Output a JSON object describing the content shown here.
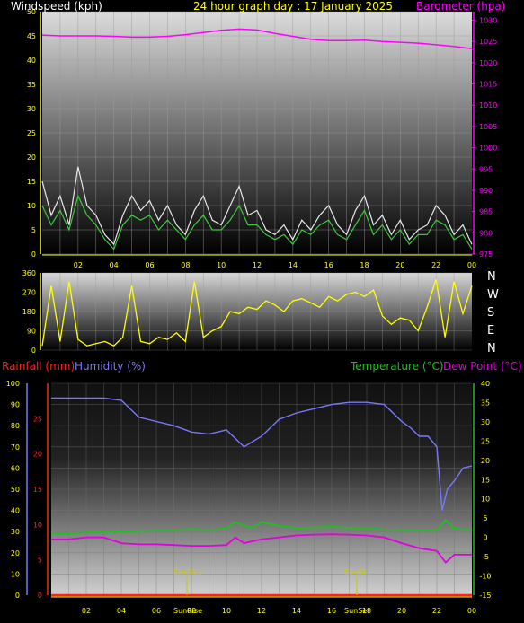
{
  "header": {
    "wind_title": "Windspeed (kph)",
    "date_title": "24 hour graph day : 17 January 2025",
    "baro_title": "Barometer (hpa)"
  },
  "lower_header": {
    "rain_title": "Rainfall (mm)",
    "hum_title": "Humidity (%)",
    "temp_title": "Temperature (°C)",
    "dew_title": "Dew Point (°C)"
  },
  "compass": [
    "N",
    "W",
    "S",
    "E",
    "N"
  ],
  "sun": {
    "rise_label": "SunRise",
    "set_label": "SunSet",
    "rise_hour": 7.6,
    "set_hour": 17.4
  },
  "colors": {
    "bg": "#000000",
    "axis_yellow": "#ffff00",
    "wind_white": "#e8e8e8",
    "wind_green": "#3cc83c",
    "baro": "#ff00ff",
    "dir": "#ffff00",
    "humidity": "#7878ff",
    "temperature": "#20c020",
    "dewpoint": "#e000e0",
    "rain": "#ff2020",
    "title_white": "#ffffff",
    "title_yellow": "#ffff00"
  },
  "chart_data": [
    {
      "type": "line",
      "title": "24 hour graph day : 17 January 2025",
      "ylabel": "Windspeed (kph)",
      "y2label": "Barometer (hpa)",
      "ylim": [
        0,
        50
      ],
      "y2lim": [
        975,
        1032
      ],
      "yticks": [
        0,
        5,
        10,
        15,
        20,
        25,
        30,
        35,
        40,
        45,
        50
      ],
      "y2ticks": [
        975,
        980,
        985,
        990,
        995,
        1000,
        1005,
        1010,
        1015,
        1020,
        1025,
        1030
      ],
      "xticks": [
        "02",
        "04",
        "06",
        "08",
        "10",
        "12",
        "14",
        "16",
        "18",
        "20",
        "22",
        "00"
      ],
      "series": [
        {
          "name": "Windspeed (kph)",
          "axis": "left",
          "x": [
            0,
            0.5,
            1,
            1.5,
            2,
            2.5,
            3,
            3.5,
            4,
            4.5,
            5,
            5.5,
            6,
            6.5,
            7,
            7.5,
            8,
            8.5,
            9,
            9.5,
            10,
            10.5,
            11,
            11.5,
            12,
            12.5,
            13,
            13.5,
            14,
            14.5,
            15,
            15.5,
            16,
            16.5,
            17,
            17.5,
            18,
            18.5,
            19,
            19.5,
            20,
            20.5,
            21,
            21.5,
            22,
            22.5,
            23,
            23.5,
            24
          ],
          "values": [
            15,
            8,
            12,
            6,
            18,
            10,
            8,
            4,
            2,
            8,
            12,
            9,
            11,
            7,
            10,
            6,
            4,
            9,
            12,
            7,
            6,
            10,
            14,
            8,
            9,
            5,
            4,
            6,
            3,
            7,
            5,
            8,
            10,
            6,
            4,
            9,
            12,
            6,
            8,
            4,
            7,
            3,
            5,
            6,
            10,
            8,
            4,
            6,
            2
          ]
        },
        {
          "name": "Wind average",
          "axis": "left",
          "x": [
            0,
            0.5,
            1,
            1.5,
            2,
            2.5,
            3,
            3.5,
            4,
            4.5,
            5,
            5.5,
            6,
            6.5,
            7,
            7.5,
            8,
            8.5,
            9,
            9.5,
            10,
            10.5,
            11,
            11.5,
            12,
            12.5,
            13,
            13.5,
            14,
            14.5,
            15,
            15.5,
            16,
            16.5,
            17,
            17.5,
            18,
            18.5,
            19,
            19.5,
            20,
            20.5,
            21,
            21.5,
            22,
            22.5,
            23,
            23.5,
            24
          ],
          "values": [
            10,
            6,
            9,
            5,
            12,
            8,
            6,
            3,
            1,
            6,
            8,
            7,
            8,
            5,
            7,
            5,
            3,
            6,
            8,
            5,
            5,
            7,
            10,
            6,
            6,
            4,
            3,
            4,
            2,
            5,
            4,
            6,
            7,
            4,
            3,
            6,
            9,
            4,
            6,
            3,
            5,
            2,
            4,
            4,
            7,
            6,
            3,
            4,
            1
          ]
        },
        {
          "name": "Barometer (hpa)",
          "axis": "right",
          "x": [
            0,
            1,
            2,
            3,
            4,
            5,
            6,
            7,
            8,
            9,
            10,
            11,
            12,
            13,
            14,
            15,
            16,
            17,
            18,
            19,
            20,
            21,
            22,
            23,
            24
          ],
          "values": [
            1026.5,
            1026.3,
            1026.3,
            1026.3,
            1026.2,
            1026,
            1026,
            1026.2,
            1026.6,
            1027.1,
            1027.6,
            1027.9,
            1027.7,
            1026.9,
            1026.2,
            1025.5,
            1025.2,
            1025.2,
            1025.3,
            1025,
            1024.8,
            1024.6,
            1024.2,
            1023.8,
            1023.3
          ]
        }
      ]
    },
    {
      "type": "line",
      "ylabel": "Wind direction",
      "ylim": [
        0,
        360
      ],
      "yticks": [
        0,
        90,
        180,
        270,
        360
      ],
      "series": [
        {
          "name": "Wind direction",
          "x": [
            0,
            0.5,
            1,
            1.5,
            2,
            2.5,
            3,
            3.5,
            4,
            4.5,
            5,
            5.5,
            6,
            6.5,
            7,
            7.5,
            8,
            8.5,
            9,
            9.5,
            10,
            10.5,
            11,
            11.5,
            12,
            12.5,
            13,
            13.5,
            14,
            14.5,
            15,
            15.5,
            16,
            16.5,
            17,
            17.5,
            18,
            18.5,
            19,
            19.5,
            20,
            20.5,
            21,
            21.5,
            22,
            22.5,
            23,
            23.5,
            24
          ],
          "values": [
            20,
            300,
            40,
            320,
            50,
            20,
            30,
            40,
            20,
            60,
            300,
            40,
            30,
            60,
            50,
            80,
            40,
            320,
            60,
            90,
            110,
            180,
            170,
            200,
            190,
            230,
            210,
            180,
            230,
            240,
            220,
            200,
            250,
            230,
            260,
            270,
            250,
            280,
            160,
            120,
            150,
            140,
            90,
            200,
            330,
            60,
            320,
            170,
            300
          ]
        }
      ]
    },
    {
      "type": "line",
      "ylabel": "Rainfall (mm) / Humidity (%)",
      "y2label": "Temperature (°C) / Dew Point (°C)",
      "humidity_ylim": [
        0,
        100
      ],
      "humidity_yticks": [
        0,
        10,
        20,
        30,
        40,
        50,
        60,
        70,
        80,
        90,
        100
      ],
      "rain_ylim": [
        0,
        30
      ],
      "rain_yticks": [
        0,
        5,
        10,
        15,
        20,
        25
      ],
      "temp_ylim": [
        -15,
        40
      ],
      "temp_yticks": [
        -15,
        -10,
        -5,
        0,
        5,
        10,
        15,
        20,
        25,
        30,
        35,
        40
      ],
      "xticks": [
        "02",
        "04",
        "06",
        "08",
        "10",
        "12",
        "14",
        "16",
        "18",
        "20",
        "22",
        "00"
      ],
      "series": [
        {
          "name": "Humidity (%)",
          "axis": "humidity",
          "x": [
            0,
            1,
            2,
            3,
            4,
            5,
            6,
            7,
            8,
            9,
            10,
            11,
            12,
            13,
            14,
            15,
            16,
            17,
            18,
            19,
            20,
            20.5,
            21,
            21.5,
            22,
            22.3,
            22.6,
            23,
            23.5,
            24
          ],
          "values": [
            93,
            93,
            93,
            93,
            92,
            84,
            82,
            80,
            77,
            76,
            78,
            70,
            75,
            83,
            86,
            88,
            90,
            91,
            91,
            90,
            82,
            79,
            75,
            75,
            70,
            40,
            50,
            54,
            60,
            61
          ]
        },
        {
          "name": "Temperature (°C)",
          "axis": "temp",
          "x": [
            0,
            1,
            2,
            3,
            4,
            5,
            6,
            7,
            8,
            9,
            10,
            10.5,
            11,
            11.5,
            12,
            13,
            14,
            15,
            16,
            17,
            18,
            19,
            20,
            21,
            22,
            22.5,
            23,
            24
          ],
          "values": [
            1,
            1,
            1.3,
            1.5,
            1.5,
            1.6,
            1.8,
            2,
            2.2,
            2,
            2.3,
            4,
            3,
            2.5,
            4,
            3,
            2.4,
            2.6,
            2.8,
            2.5,
            2.3,
            2.1,
            2,
            1.8,
            1.8,
            4.5,
            2.3,
            2
          ]
        },
        {
          "name": "Dew Point (°C)",
          "axis": "temp",
          "x": [
            0,
            1,
            2,
            3,
            4,
            5,
            6,
            7,
            8,
            9,
            10,
            10.5,
            11,
            11.5,
            12,
            13,
            14,
            15,
            16,
            17,
            18,
            19,
            20,
            21,
            22,
            22.5,
            23,
            24
          ],
          "values": [
            -0.5,
            -0.5,
            0,
            0,
            -1.5,
            -1.8,
            -1.8,
            -2,
            -2.2,
            -2.2,
            -2,
            0,
            -1.5,
            -1,
            -0.5,
            0,
            0.5,
            0.7,
            0.8,
            0.7,
            0.5,
            0,
            -1.5,
            -2.8,
            -3.5,
            -6.5,
            -4.5,
            -4.5
          ]
        },
        {
          "name": "Rainfall (mm)",
          "axis": "rain",
          "x": [
            0,
            24
          ],
          "values": [
            0,
            0
          ]
        }
      ]
    }
  ]
}
